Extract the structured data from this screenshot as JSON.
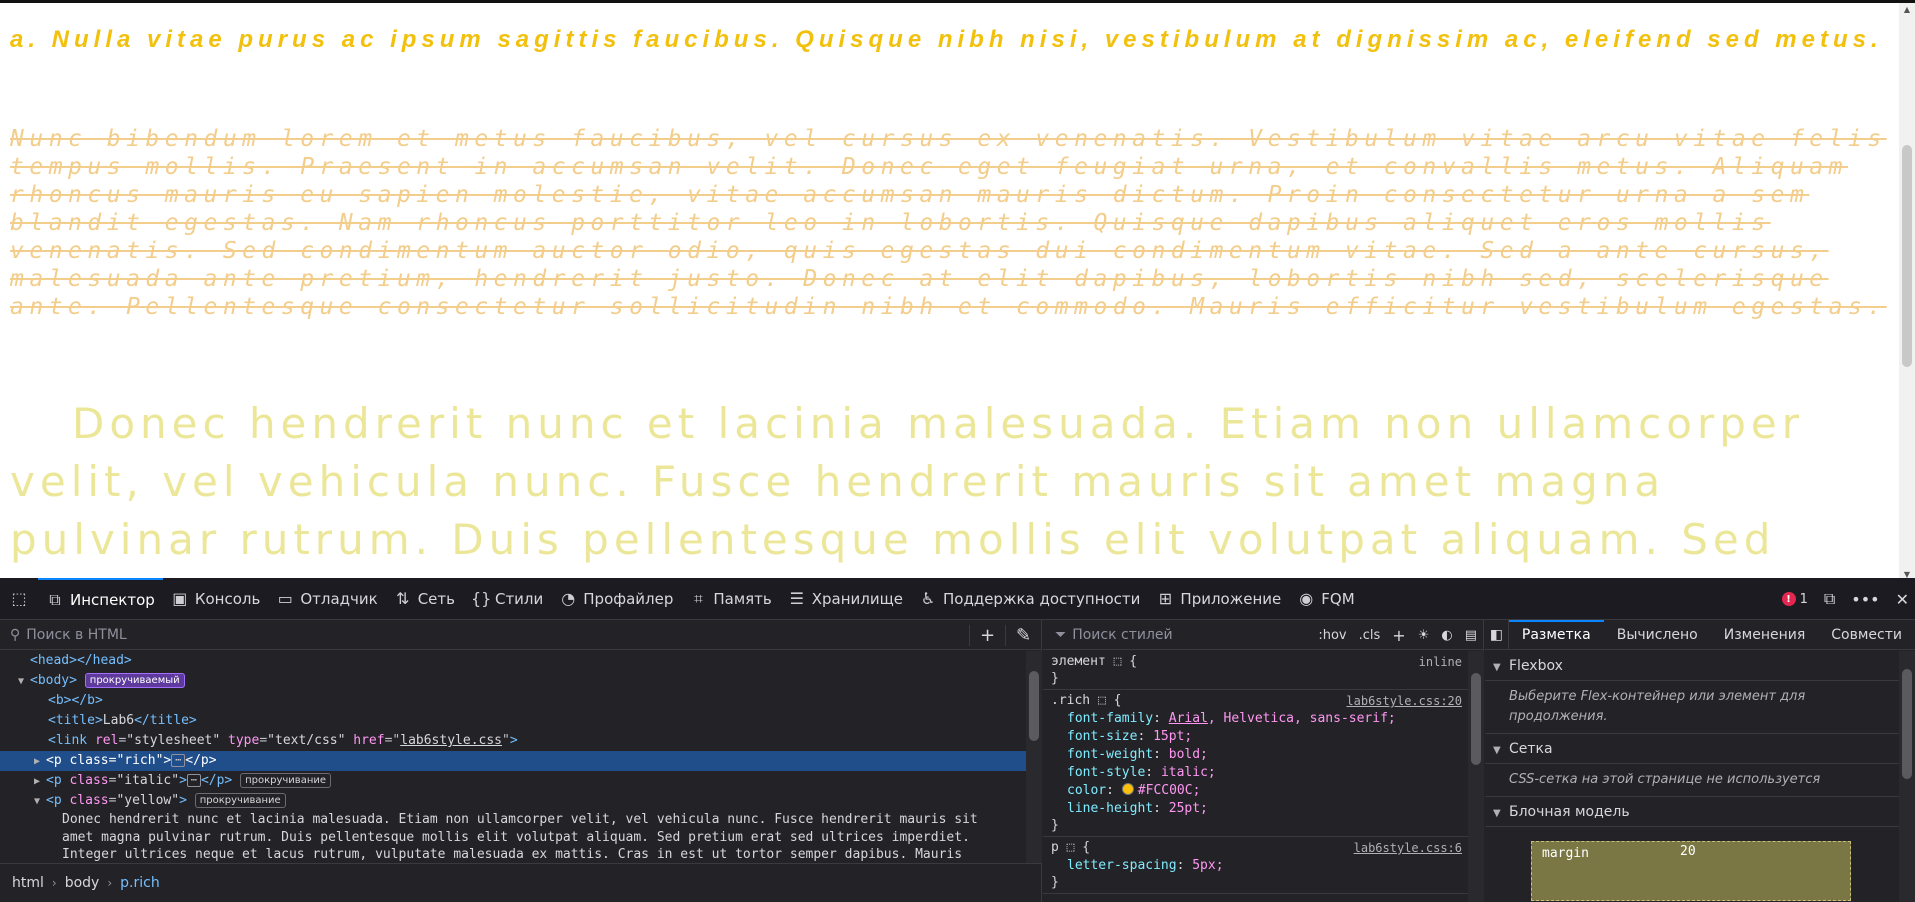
{
  "page": {
    "rich_text": "a. Nulla vitae purus ac ipsum sagittis faucibus. Quisque nibh nisi, vestibulum at dignissim ac, eleifend sed metus.",
    "italic_text": "Nunc bibendum lorem et metus faucibus, vel cursus ex venenatis. Vestibulum vitae arcu vitae felis tempus mollis. Praesent in accumsan velit. Donec eget feugiat urna, et convallis metus. Aliquam rhoncus mauris eu sapien molestie, vitae accumsan mauris dictum. Proin consectetur urna a sem blandit egestas. Nam rhoncus porttitor leo in lobortis. Quisque dapibus aliquet eros mollis venenatis. Sed condimentum auctor odio, quis egestas dui condimentum vitae. Sed a ante cursus, malesuada ante pretium, hendrerit justo. Donec at elit dapibus, lobortis nibh sed, scelerisque ante. Pellentesque consectetur sollicitudin nibh et commodo. Mauris efficitur vestibulum egestas.",
    "yellow_text": "Donec hendrerit nunc et lacinia malesuada. Etiam non ullamcorper velit, vel vehicula nunc. Fusce hendrerit mauris sit amet magna pulvinar rutrum. Duis pellentesque mollis elit volutpat aliquam. Sed pretium erat",
    "colors": {
      "rich": "#f2c10d",
      "italic": "#f3cd8b",
      "yellow": "#ece798"
    }
  },
  "toolbar": {
    "tools": [
      {
        "label": "Инспектор",
        "icon": "inspector-icon"
      },
      {
        "label": "Консоль",
        "icon": "console-icon"
      },
      {
        "label": "Отладчик",
        "icon": "debugger-icon"
      },
      {
        "label": "Сеть",
        "icon": "network-icon"
      },
      {
        "label": "Стили",
        "icon": "style-editor-icon"
      },
      {
        "label": "Профайлер",
        "icon": "profiler-icon"
      },
      {
        "label": "Память",
        "icon": "memory-icon"
      },
      {
        "label": "Хранилище",
        "icon": "storage-icon"
      },
      {
        "label": "Поддержка доступности",
        "icon": "accessibility-icon"
      },
      {
        "label": "Приложение",
        "icon": "application-icon"
      },
      {
        "label": "FQM",
        "icon": "fqm-icon"
      }
    ],
    "error_count": "1",
    "accent": "#0a84ff"
  },
  "markup": {
    "search_placeholder": "Поиск в HTML",
    "nodes": {
      "head": "<head></head>",
      "body_tag": "<body>",
      "body_badge": "прокручиваемый",
      "b": "<b></b>",
      "title_open": "<title>",
      "title_text": "Lab6",
      "title_close": "</title>",
      "link_open": "<link",
      "link_rel_name": "rel",
      "link_rel_val": "\"stylesheet\"",
      "link_type_name": "type",
      "link_type_val": "\"text/css\"",
      "link_href_name": "href",
      "link_href_val": "lab6style.css",
      "p_rich_open": "<p",
      "p_rich_class_name": "class",
      "p_rich_class_val": "\"rich\"",
      "p_italic_class_val": "\"italic\"",
      "p_italic_badge": "прокручивание",
      "p_yellow_class_val": "\"yellow\"",
      "p_yellow_badge": "прокручивание",
      "p_close": "</p>",
      "yellow_text": "Donec hendrerit nunc et lacinia malesuada. Etiam non ullamcorper velit, vel vehicula nunc. Fusce hendrerit mauris sit amet magna pulvinar rutrum. Duis pellentesque mollis elit volutpat aliquam. Sed pretium erat sed ultrices imperdiet. Integer ultrices neque et lacus rutrum, vulputate malesuada ex mattis. Cras in est ut tortor semper dapibus. Mauris"
    },
    "breadcrumbs": [
      "html",
      "body",
      "p.rich"
    ]
  },
  "rules": {
    "filter_placeholder": "Поиск стилей",
    "hov_label": ":hov",
    "cls_label": ".cls",
    "element_rule": {
      "selector": "элемент",
      "source": "inline"
    },
    "rich_rule": {
      "selector": ".rich",
      "source": "lab6style.css:20",
      "decls": [
        {
          "prop": "font-family",
          "value_link": "Arial",
          "value_rest": ", Helvetica, sans-serif;"
        },
        {
          "prop": "font-size",
          "value": "15pt;"
        },
        {
          "prop": "font-weight",
          "value": "bold;"
        },
        {
          "prop": "font-style",
          "value": "italic;"
        },
        {
          "prop": "color",
          "value": "#FCC00C;"
        },
        {
          "prop": "line-height",
          "value": "25pt;"
        }
      ]
    },
    "p_rule": {
      "selector": "p",
      "source": "lab6style.css:6",
      "decls": [
        {
          "prop": "letter-spacing",
          "value": "5px;"
        }
      ]
    }
  },
  "layout": {
    "tabs": [
      "Разметка",
      "Вычислено",
      "Изменения",
      "Совмести"
    ],
    "flexbox_title": "Flexbox",
    "flexbox_msg": "Выберите Flex-контейнер или элемент для продолжения.",
    "grid_title": "Сетка",
    "grid_msg": "CSS-сетка на этой странице не используется",
    "boxmodel_title": "Блочная модель",
    "margin_label": "margin",
    "margin_top": "20"
  }
}
